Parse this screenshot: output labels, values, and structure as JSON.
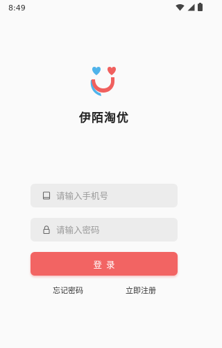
{
  "status_bar": {
    "time": "8:49",
    "icons": [
      "wifi-icon",
      "cellular-signal-icon",
      "battery-icon"
    ]
  },
  "app": {
    "name": "伊陌淘优",
    "logo_colors": {
      "heart_left": "#4fb3ea",
      "heart_right": "#f0605e",
      "smile": "#f0605e",
      "smile_shadow": "#4fb3ea"
    }
  },
  "form": {
    "phone": {
      "placeholder": "请输入手机号",
      "value": "",
      "icon": "phone-icon"
    },
    "password": {
      "placeholder": "请输入密码",
      "value": "",
      "icon": "lock-icon"
    },
    "login_label": "登录"
  },
  "links": {
    "forgot_password": "忘记密码",
    "register": "立即注册"
  },
  "colors": {
    "accent": "#f26463",
    "field_bg": "#ececec",
    "background": "#fafafa"
  }
}
